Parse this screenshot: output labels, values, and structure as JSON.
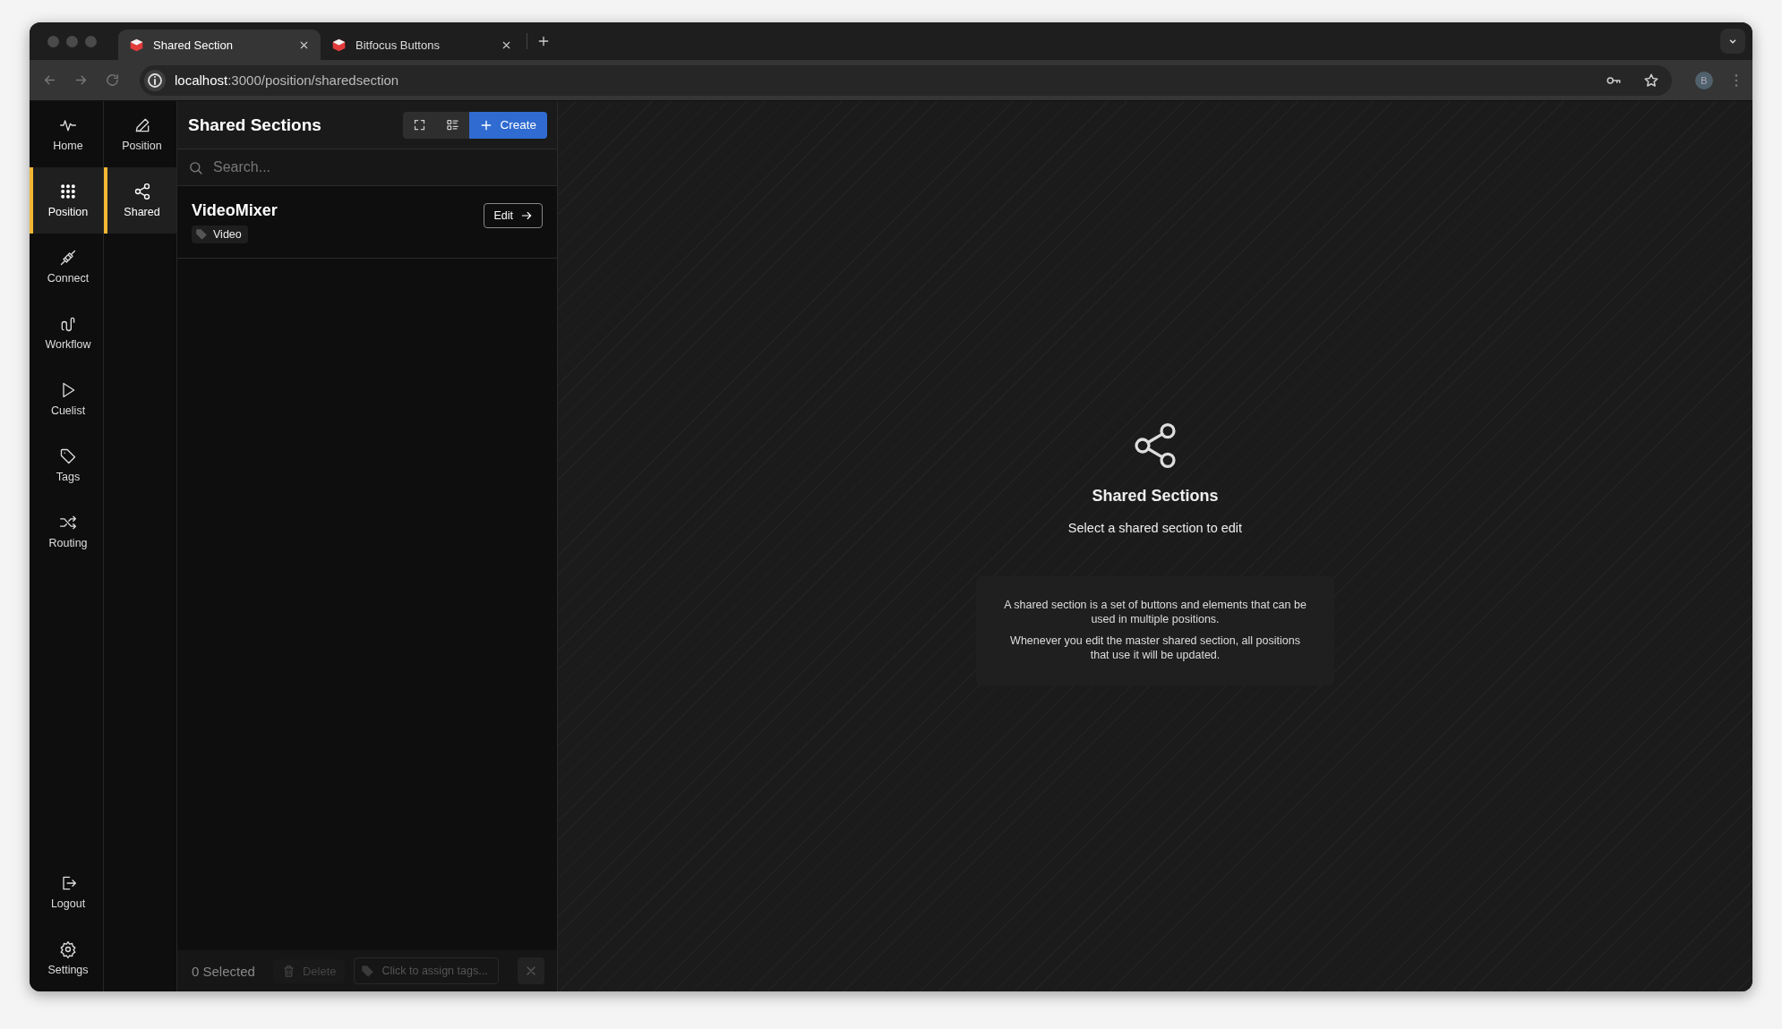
{
  "browser": {
    "tabs": [
      {
        "title": "Shared Section",
        "selected": true
      },
      {
        "title": "Bitfocus Buttons",
        "selected": false
      }
    ],
    "address": {
      "host": "localhost",
      "path": ":3000/position/sharedsection"
    },
    "profile": "B"
  },
  "rail": {
    "items": [
      {
        "label": "Home",
        "selected": false
      },
      {
        "label": "Position",
        "selected": true
      },
      {
        "label": "Connect",
        "selected": false
      },
      {
        "label": "Workflow",
        "selected": false
      },
      {
        "label": "Cuelist",
        "selected": false
      },
      {
        "label": "Tags",
        "selected": false
      },
      {
        "label": "Routing",
        "selected": false
      }
    ],
    "bottom_items": [
      {
        "label": "Logout"
      },
      {
        "label": "Settings"
      }
    ]
  },
  "subnav": {
    "items": [
      {
        "label": "Position",
        "selected": false
      },
      {
        "label": "Shared",
        "selected": true
      }
    ]
  },
  "list": {
    "title": "Shared Sections",
    "create": "Create",
    "search": {
      "placeholder": "Search..."
    },
    "items": [
      {
        "name": "VideoMixer",
        "tag": "Video",
        "action": "Edit"
      }
    ],
    "footer": {
      "selected_count": "0 Selected",
      "delete": {
        "label": "Delete",
        "disabled": true
      },
      "tags": {
        "placeholder": "Click to assign tags..."
      }
    }
  },
  "detail": {
    "title": "Shared Sections",
    "subtitle": "Select a shared section to edit",
    "paragraphs": [
      "A shared section is a set of buttons and elements that can be used in multiple positions.",
      "Whenever you edit the master shared section, all positions that use it will be updated."
    ]
  }
}
